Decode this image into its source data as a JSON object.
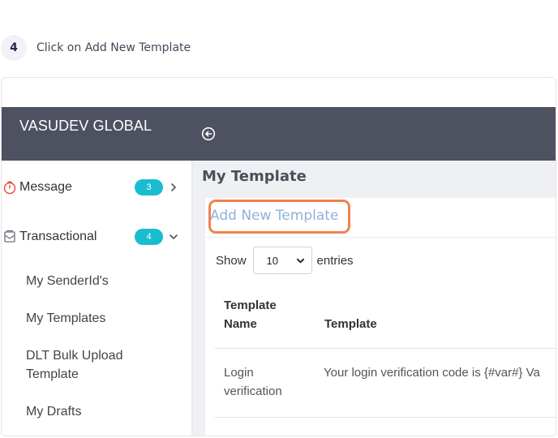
{
  "step": {
    "number": "4",
    "text": "Click on Add New Template"
  },
  "app": {
    "brand": "VASUDEV GLOBAL"
  },
  "sidebar": {
    "menus": [
      {
        "label": "Message",
        "badge": "3"
      },
      {
        "label": "Transactional",
        "badge": "4"
      }
    ],
    "subitems": [
      {
        "label": "My SenderId's"
      },
      {
        "label": "My Templates"
      },
      {
        "label": "DLT Bulk Upload Template"
      },
      {
        "label": "My Drafts"
      }
    ]
  },
  "main": {
    "title": "My Template",
    "add_link": "Add New Template",
    "show_label": "Show",
    "page_size": "10",
    "entries_label": "entries",
    "columns": [
      "Template Name",
      "Template"
    ],
    "rows": [
      {
        "name": "Login verification",
        "template": "Your login verification code is {#var#} Va"
      }
    ]
  },
  "colors": {
    "topbar": "#4d5160",
    "badge": "#18bdcf",
    "link": "#8fb3d9",
    "highlight": "#f0824d"
  }
}
